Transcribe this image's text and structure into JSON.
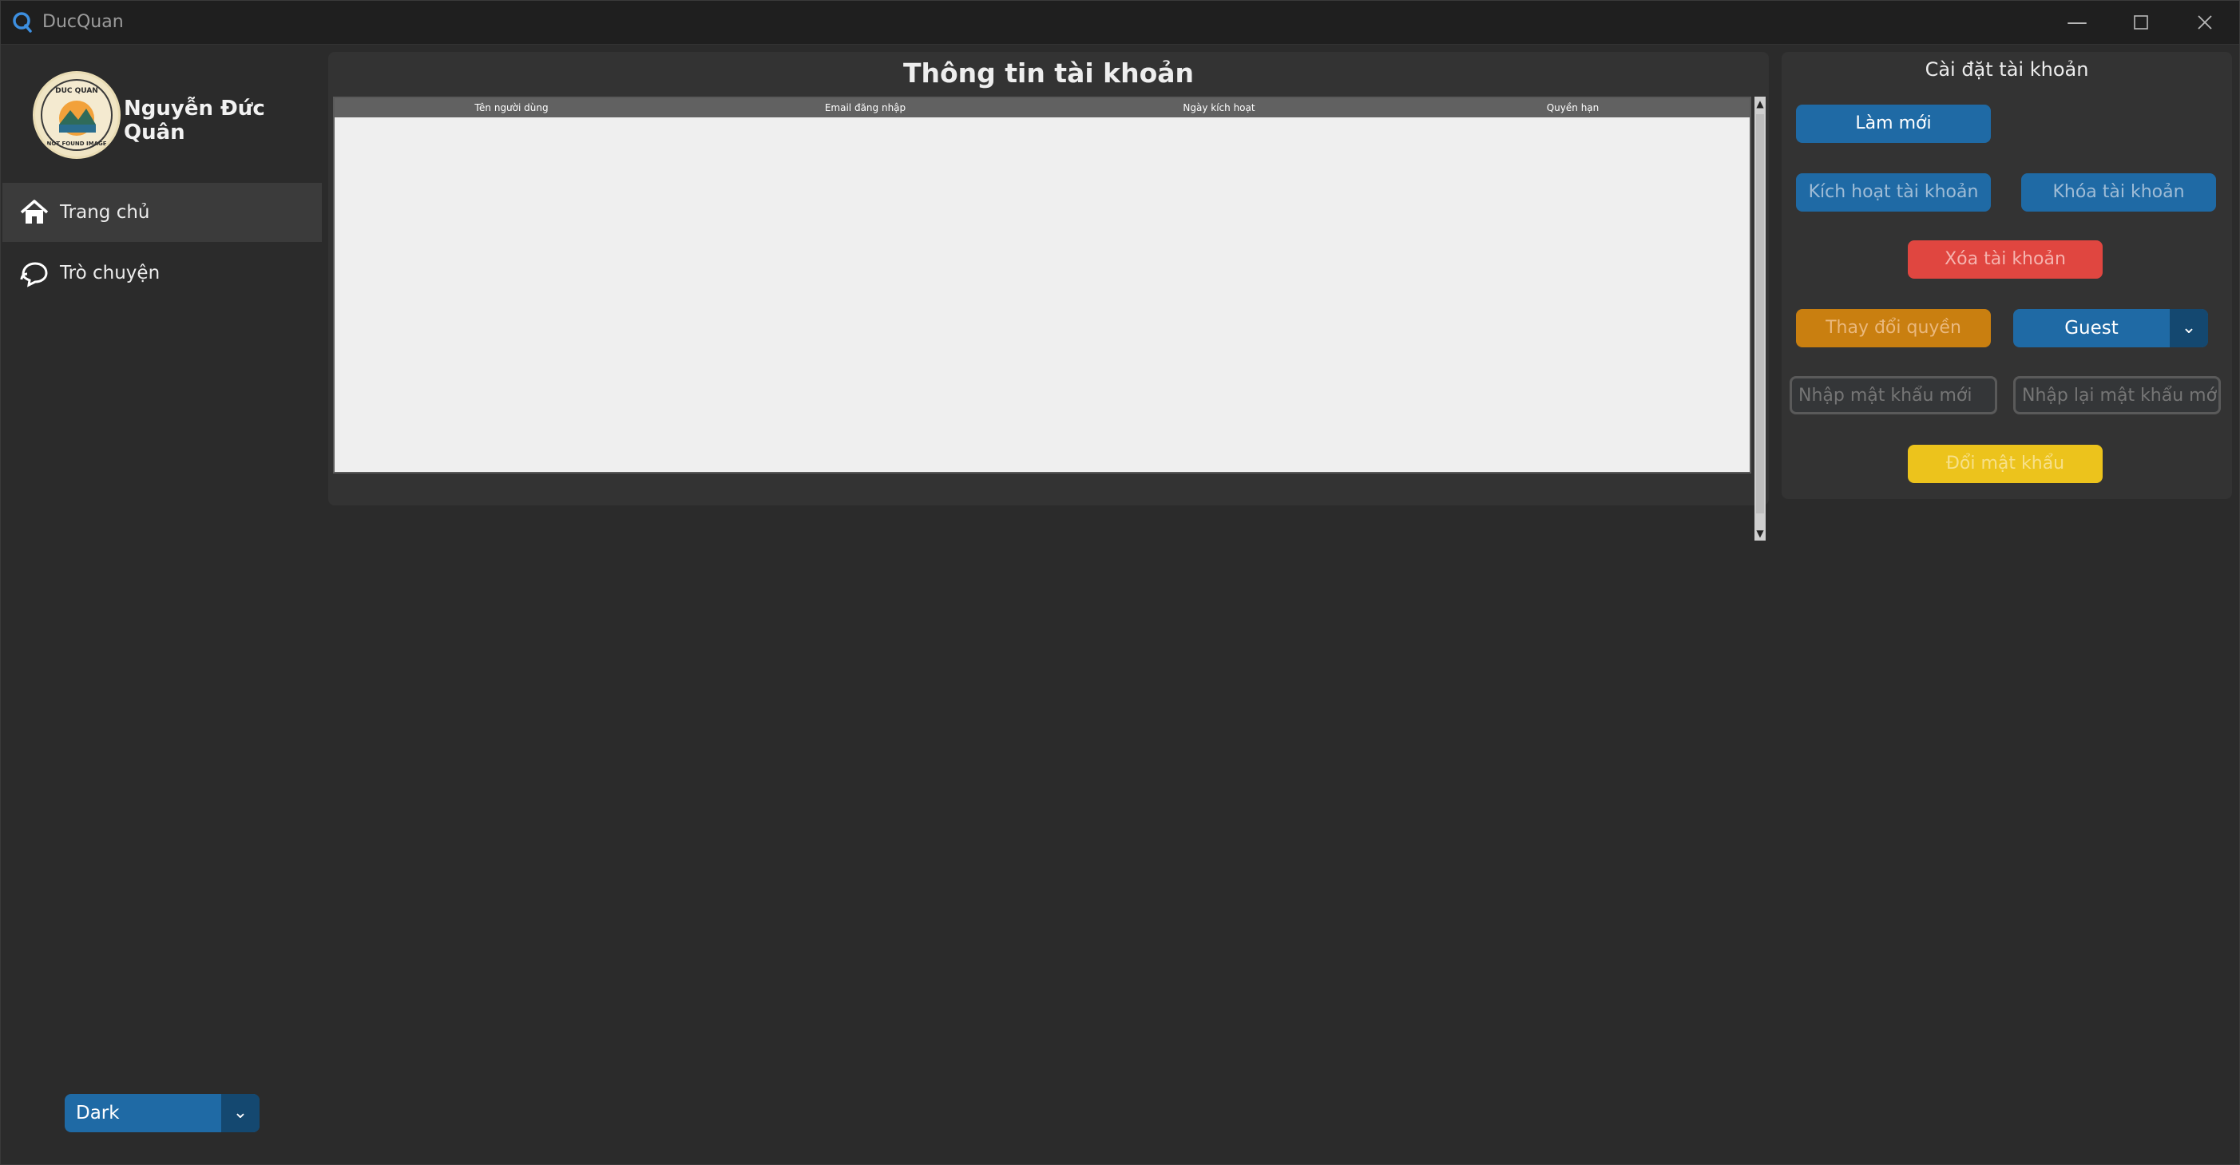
{
  "window": {
    "title": "DucQuan",
    "controls": [
      "minimize-icon",
      "maximize-icon",
      "close-icon"
    ]
  },
  "sidebar": {
    "user_name": "Nguyễn Đức Quân",
    "avatar_text_top": "DUC QUAN",
    "avatar_text_bottom": "NOT FOUND IMAGE",
    "items": [
      {
        "label": "Trang chủ",
        "icon": "home-icon",
        "active": true
      },
      {
        "label": "Trò chuyện",
        "icon": "chat-icon",
        "active": false
      }
    ],
    "theme": {
      "value": "Dark"
    }
  },
  "main": {
    "title": "Thông tin tài khoản",
    "table": {
      "columns": [
        "Tên người dùng",
        "Email đăng nhập",
        "Ngày kích hoạt",
        "Quyền hạn"
      ],
      "rows": []
    }
  },
  "settings": {
    "title": "Cài đặt tài khoản",
    "refresh_label": "Làm mới",
    "activate_label": "Kích hoạt tài khoản",
    "lock_label": "Khóa tài khoản",
    "delete_label": "Xóa tài khoản",
    "change_role_label": "Thay đổi quyền",
    "role_value": "Guest",
    "new_password_placeholder": "Nhập mật khẩu mới",
    "confirm_password_placeholder": "Nhập lại mật khẩu mới",
    "change_password_label": "Đổi mật khẩu"
  },
  "colors": {
    "accent": "#1f6aa5",
    "danger": "#e04640",
    "warning": "#c97f10",
    "highlight": "#ecc31c",
    "background": "#2b2b2b"
  }
}
